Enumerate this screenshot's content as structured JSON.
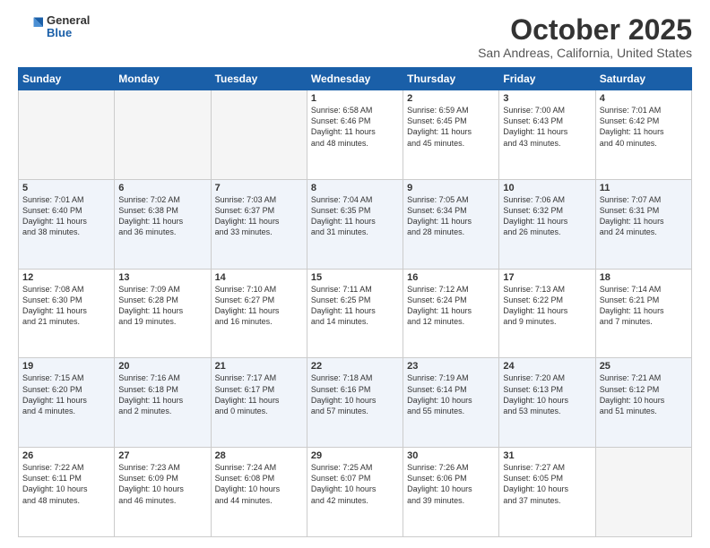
{
  "header": {
    "logo_general": "General",
    "logo_blue": "Blue",
    "month_title": "October 2025",
    "location": "San Andreas, California, United States"
  },
  "days_of_week": [
    "Sunday",
    "Monday",
    "Tuesday",
    "Wednesday",
    "Thursday",
    "Friday",
    "Saturday"
  ],
  "weeks": [
    [
      {
        "day": "",
        "info": ""
      },
      {
        "day": "",
        "info": ""
      },
      {
        "day": "",
        "info": ""
      },
      {
        "day": "1",
        "info": "Sunrise: 6:58 AM\nSunset: 6:46 PM\nDaylight: 11 hours\nand 48 minutes."
      },
      {
        "day": "2",
        "info": "Sunrise: 6:59 AM\nSunset: 6:45 PM\nDaylight: 11 hours\nand 45 minutes."
      },
      {
        "day": "3",
        "info": "Sunrise: 7:00 AM\nSunset: 6:43 PM\nDaylight: 11 hours\nand 43 minutes."
      },
      {
        "day": "4",
        "info": "Sunrise: 7:01 AM\nSunset: 6:42 PM\nDaylight: 11 hours\nand 40 minutes."
      }
    ],
    [
      {
        "day": "5",
        "info": "Sunrise: 7:01 AM\nSunset: 6:40 PM\nDaylight: 11 hours\nand 38 minutes."
      },
      {
        "day": "6",
        "info": "Sunrise: 7:02 AM\nSunset: 6:38 PM\nDaylight: 11 hours\nand 36 minutes."
      },
      {
        "day": "7",
        "info": "Sunrise: 7:03 AM\nSunset: 6:37 PM\nDaylight: 11 hours\nand 33 minutes."
      },
      {
        "day": "8",
        "info": "Sunrise: 7:04 AM\nSunset: 6:35 PM\nDaylight: 11 hours\nand 31 minutes."
      },
      {
        "day": "9",
        "info": "Sunrise: 7:05 AM\nSunset: 6:34 PM\nDaylight: 11 hours\nand 28 minutes."
      },
      {
        "day": "10",
        "info": "Sunrise: 7:06 AM\nSunset: 6:32 PM\nDaylight: 11 hours\nand 26 minutes."
      },
      {
        "day": "11",
        "info": "Sunrise: 7:07 AM\nSunset: 6:31 PM\nDaylight: 11 hours\nand 24 minutes."
      }
    ],
    [
      {
        "day": "12",
        "info": "Sunrise: 7:08 AM\nSunset: 6:30 PM\nDaylight: 11 hours\nand 21 minutes."
      },
      {
        "day": "13",
        "info": "Sunrise: 7:09 AM\nSunset: 6:28 PM\nDaylight: 11 hours\nand 19 minutes."
      },
      {
        "day": "14",
        "info": "Sunrise: 7:10 AM\nSunset: 6:27 PM\nDaylight: 11 hours\nand 16 minutes."
      },
      {
        "day": "15",
        "info": "Sunrise: 7:11 AM\nSunset: 6:25 PM\nDaylight: 11 hours\nand 14 minutes."
      },
      {
        "day": "16",
        "info": "Sunrise: 7:12 AM\nSunset: 6:24 PM\nDaylight: 11 hours\nand 12 minutes."
      },
      {
        "day": "17",
        "info": "Sunrise: 7:13 AM\nSunset: 6:22 PM\nDaylight: 11 hours\nand 9 minutes."
      },
      {
        "day": "18",
        "info": "Sunrise: 7:14 AM\nSunset: 6:21 PM\nDaylight: 11 hours\nand 7 minutes."
      }
    ],
    [
      {
        "day": "19",
        "info": "Sunrise: 7:15 AM\nSunset: 6:20 PM\nDaylight: 11 hours\nand 4 minutes."
      },
      {
        "day": "20",
        "info": "Sunrise: 7:16 AM\nSunset: 6:18 PM\nDaylight: 11 hours\nand 2 minutes."
      },
      {
        "day": "21",
        "info": "Sunrise: 7:17 AM\nSunset: 6:17 PM\nDaylight: 11 hours\nand 0 minutes."
      },
      {
        "day": "22",
        "info": "Sunrise: 7:18 AM\nSunset: 6:16 PM\nDaylight: 10 hours\nand 57 minutes."
      },
      {
        "day": "23",
        "info": "Sunrise: 7:19 AM\nSunset: 6:14 PM\nDaylight: 10 hours\nand 55 minutes."
      },
      {
        "day": "24",
        "info": "Sunrise: 7:20 AM\nSunset: 6:13 PM\nDaylight: 10 hours\nand 53 minutes."
      },
      {
        "day": "25",
        "info": "Sunrise: 7:21 AM\nSunset: 6:12 PM\nDaylight: 10 hours\nand 51 minutes."
      }
    ],
    [
      {
        "day": "26",
        "info": "Sunrise: 7:22 AM\nSunset: 6:11 PM\nDaylight: 10 hours\nand 48 minutes."
      },
      {
        "day": "27",
        "info": "Sunrise: 7:23 AM\nSunset: 6:09 PM\nDaylight: 10 hours\nand 46 minutes."
      },
      {
        "day": "28",
        "info": "Sunrise: 7:24 AM\nSunset: 6:08 PM\nDaylight: 10 hours\nand 44 minutes."
      },
      {
        "day": "29",
        "info": "Sunrise: 7:25 AM\nSunset: 6:07 PM\nDaylight: 10 hours\nand 42 minutes."
      },
      {
        "day": "30",
        "info": "Sunrise: 7:26 AM\nSunset: 6:06 PM\nDaylight: 10 hours\nand 39 minutes."
      },
      {
        "day": "31",
        "info": "Sunrise: 7:27 AM\nSunset: 6:05 PM\nDaylight: 10 hours\nand 37 minutes."
      },
      {
        "day": "",
        "info": ""
      }
    ]
  ]
}
